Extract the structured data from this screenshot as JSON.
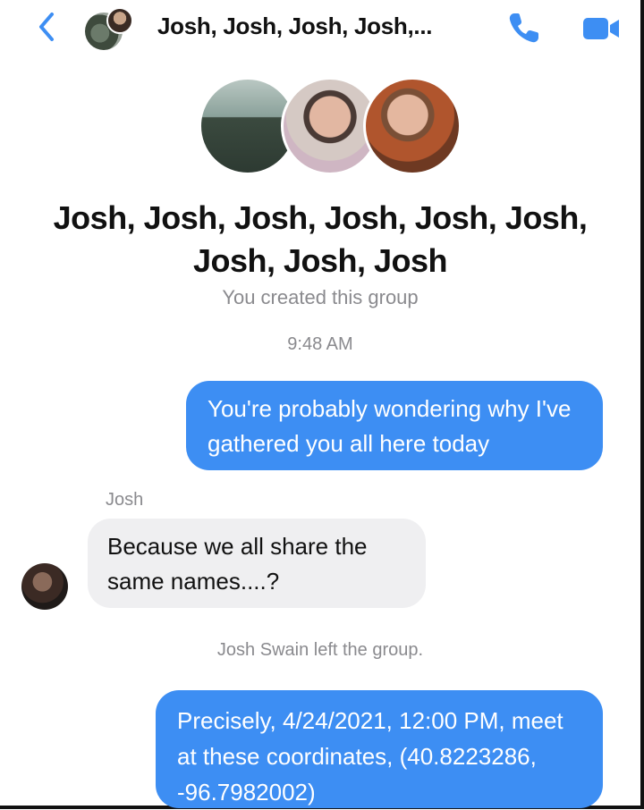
{
  "header": {
    "title": "Josh, Josh, Josh, Josh,...",
    "back_icon": "chevron-left-icon",
    "call_icon": "phone-icon",
    "video_icon": "video-camera-icon",
    "accent": "#3d8ef3"
  },
  "group": {
    "name": "Josh, Josh, Josh, Josh, Josh, Josh, Josh, Josh, Josh",
    "created_text": "You created this group"
  },
  "messages": [
    {
      "type": "timestamp",
      "text": "9:48 AM"
    },
    {
      "type": "outgoing",
      "text": "You're probably wondering why I've gathered you all here today"
    },
    {
      "type": "incoming",
      "sender": "Josh",
      "text": "Because we all share the same names....?"
    },
    {
      "type": "system",
      "text": "Josh Swain left the group."
    },
    {
      "type": "outgoing",
      "text": "Precisely, 4/24/2021, 12:00 PM, meet at these coordinates, (40.8223286, -96.7982002)"
    }
  ],
  "colors": {
    "outgoing_bubble": "#3d8ef3",
    "incoming_bubble": "#efeff1",
    "meta_text": "#8a8a8e"
  }
}
